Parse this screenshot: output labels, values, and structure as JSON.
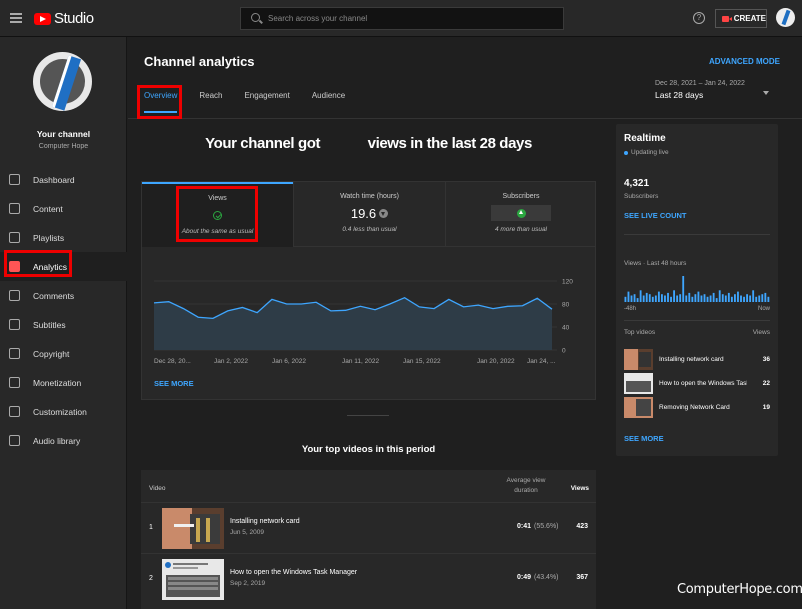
{
  "app": {
    "name": "Studio"
  },
  "search": {
    "placeholder": "Search across your channel"
  },
  "header": {
    "create_label": "CREATE"
  },
  "sidebar": {
    "channel_name": "Your channel",
    "channel_sub": "Computer Hope",
    "items": [
      {
        "label": "Dashboard",
        "icon": "dashboard-icon"
      },
      {
        "label": "Content",
        "icon": "content-icon"
      },
      {
        "label": "Playlists",
        "icon": "playlists-icon"
      },
      {
        "label": "Analytics",
        "icon": "analytics-icon",
        "active": true
      },
      {
        "label": "Comments",
        "icon": "comments-icon"
      },
      {
        "label": "Subtitles",
        "icon": "subtitles-icon"
      },
      {
        "label": "Copyright",
        "icon": "copyright-icon"
      },
      {
        "label": "Monetization",
        "icon": "monetization-icon"
      },
      {
        "label": "Customization",
        "icon": "customization-icon"
      },
      {
        "label": "Audio library",
        "icon": "audio-library-icon"
      }
    ]
  },
  "main": {
    "title": "Channel analytics",
    "advanced_mode": "ADVANCED MODE",
    "tabs": [
      "Overview",
      "Reach",
      "Engagement",
      "Audience"
    ],
    "date_range": {
      "sub": "Dec 28, 2021 – Jan 24, 2022",
      "main": "Last 28 days"
    },
    "headline_start": "Your channel got",
    "headline_end": "views in the last 28 days",
    "metrics": [
      {
        "label": "Views",
        "value": "",
        "note": "About the same as usual"
      },
      {
        "label": "Watch time (hours)",
        "value": "19.6",
        "note": "0.4 less than usual"
      },
      {
        "label": "Subscribers",
        "value": "",
        "note": "4 more than usual"
      }
    ],
    "see_more": "SEE MORE",
    "top_videos_title": "Your top videos in this period",
    "table": {
      "col_video": "Video",
      "col_avg_line1": "Average view",
      "col_avg_line2": "duration",
      "col_views": "Views",
      "rows": [
        {
          "rank": "1",
          "title": "Installing network card",
          "date": "Jun 5, 2009",
          "duration": "0:41",
          "pct": "(55.6%)",
          "views": "423"
        },
        {
          "rank": "2",
          "title": "How to open the Windows Task Manager",
          "date": "Sep 2, 2019",
          "duration": "0:49",
          "pct": "(43.4%)",
          "views": "367"
        }
      ]
    }
  },
  "chart_data": {
    "type": "area",
    "x_ticks": [
      "Dec 28, 20...",
      "Jan 2, 2022",
      "Jan 6, 2022",
      "Jan 11, 2022",
      "Jan 15, 2022",
      "Jan 20, 2022",
      "Jan 24, ..."
    ],
    "y_ticks": [
      "120",
      "80",
      "40",
      "0"
    ],
    "ylim": [
      0,
      120
    ],
    "grid": true,
    "series": [
      {
        "values": [
          82,
          84,
          72,
          57,
          55,
          68,
          74,
          65,
          88,
          80,
          80,
          83,
          68,
          69,
          76,
          70,
          80,
          91,
          75,
          72,
          88,
          75,
          78,
          72,
          76,
          77,
          90,
          71
        ]
      }
    ],
    "color": "#3ea6ff"
  },
  "realtime": {
    "title": "Realtime",
    "status": "Updating live",
    "subscribers": "4,321",
    "subscribers_label": "Subscribers",
    "live_count": "SEE LIVE COUNT",
    "views_label": "Views · Last 48 hours",
    "start_label": "-48h",
    "end_label": "Now",
    "bars": [
      4,
      8,
      5,
      6,
      3,
      9,
      5,
      7,
      6,
      4,
      5,
      8,
      6,
      5,
      7,
      4,
      9,
      5,
      6,
      20,
      5,
      7,
      4,
      6,
      8,
      5,
      6,
      4,
      5,
      7,
      3,
      9,
      6,
      5,
      7,
      4,
      6,
      8,
      5,
      4,
      6,
      5,
      9,
      4,
      5,
      6,
      7,
      4
    ],
    "top_videos_label": "Top videos",
    "views_col": "Views",
    "top_videos": [
      {
        "title": "Installing network card",
        "views": "36"
      },
      {
        "title": "How to open the Windows Task Manager",
        "views": "22"
      },
      {
        "title": "Removing Network Card",
        "views": "19"
      }
    ],
    "see_more": "SEE MORE"
  },
  "watermark": "ComputerHope.com",
  "colors": {
    "accent": "#3ea6ff",
    "brand": "#ff0000",
    "highlight": "#e00000",
    "positive": "#2ba640"
  }
}
